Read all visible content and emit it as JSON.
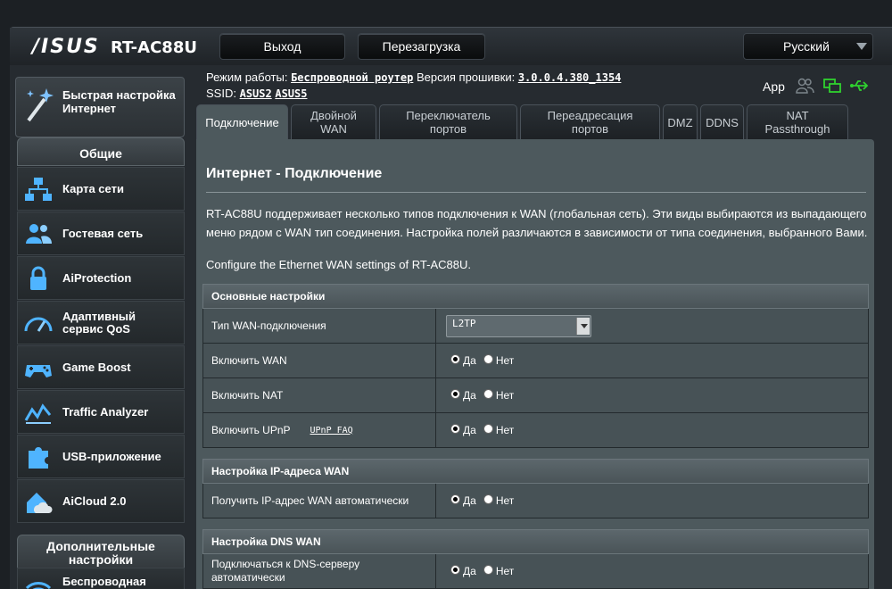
{
  "header": {
    "brand": "/ISUS",
    "model": "RT-AC88U",
    "logout_label": "Выход",
    "reboot_label": "Перезагрузка",
    "language": "Русский"
  },
  "status": {
    "mode_label": "Режим работы:",
    "mode_value": "Беспроводной роутер",
    "firmware_label": "Версия прошивки:",
    "firmware_value": "3.0.0.4.380_1354",
    "ssid_label": "SSID:",
    "ssid_1": "ASUS2",
    "ssid_2": "ASUS5",
    "app_label": "App"
  },
  "tabs": [
    {
      "label": "Подключение"
    },
    {
      "label": "Двойной WAN"
    },
    {
      "label": "Переключатель портов"
    },
    {
      "label": "Переадресация портов"
    },
    {
      "label": "DMZ"
    },
    {
      "label": "DDNS"
    },
    {
      "label": "NAT Passthrough"
    }
  ],
  "sidebar": {
    "quick_setup": "Быстрая настройка Интернет",
    "general_header": "Общие",
    "items": [
      {
        "label": "Карта сети"
      },
      {
        "label": "Гостевая сеть"
      },
      {
        "label": "AiProtection"
      },
      {
        "label": "Адаптивный сервис QoS"
      },
      {
        "label": "Game Boost"
      },
      {
        "label": "Traffic Analyzer"
      },
      {
        "label": "USB-приложение"
      },
      {
        "label": "AiCloud 2.0"
      }
    ],
    "advanced_header": "Дополнительные настройки",
    "advanced_first": "Беспроводная"
  },
  "main": {
    "title": "Интернет - Подключение",
    "description": "RT-AC88U поддерживает несколько типов подключения к WAN (глобальная сеть). Эти виды выбираются из выпадающего меню рядом с WAN тип соединения. Настройка полей различаются в зависимости от типа соединения, выбранного Вами.",
    "configure_text": "Configure the Ethernet WAN settings of RT-AC88U.",
    "radio_yes": "Да",
    "radio_no": "Нет",
    "basic": {
      "header": "Основные настройки",
      "wan_type_label": "Тип WAN-подключения",
      "wan_type_value": "L2TP",
      "enable_wan_label": "Включить WAN",
      "enable_nat_label": "Включить NAT",
      "enable_upnp_label": "Включить UPnP",
      "upnp_faq": "UPnP  FAQ"
    },
    "ip": {
      "header": "Настройка IP-адреса WAN",
      "auto_ip_label": "Получить IP-адрес WAN автоматически"
    },
    "dns": {
      "header": "Настройка DNS WAN",
      "auto_dns_label": "Подключаться к DNS-серверу автоматически"
    }
  }
}
